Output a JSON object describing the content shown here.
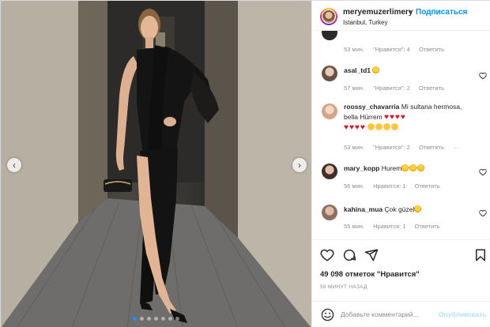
{
  "post": {
    "username": "meryemuzerlimery",
    "separator": "•",
    "follow_label": "Подписаться",
    "location": "Istanbul, Turkey",
    "likes": "49 098 отметок \"Нравится\"",
    "time_ago": "58 МИНУТ НАЗАД",
    "carousel_pages": 7,
    "carousel_active": 0
  },
  "comments": [
    {
      "username": "",
      "text": "",
      "time": "53 мин.",
      "likes": "\"Нравится\": 4",
      "reply": "Ответить",
      "avatar_color": "#2b2b2b"
    },
    {
      "username": "asal_td1",
      "text": "",
      "emojis": [
        "star"
      ],
      "time": "57 мин.",
      "likes": "\"Нравится\": 2",
      "reply": "Ответить",
      "avatar_color": "#9a8d86"
    },
    {
      "username": "roossy_chavarria",
      "text": "Mi sultana hermosa, bella Hürrem",
      "time": "53 мин.",
      "likes": "\"Нравится\": 2",
      "reply": "Ответить",
      "avatar_color": "#e7c3b0"
    },
    {
      "username": "mary_kopp",
      "text": "Hurem",
      "time": "56 мин.",
      "likes": "Нравится: 1",
      "reply": "Ответить",
      "avatar_color": "#5b4a45"
    },
    {
      "username": "kahina_mua",
      "text": "Çok güzel",
      "time": "55 мин.",
      "likes": "Нравится: 1",
      "reply": "Ответить",
      "avatar_color": "#b79a8e"
    }
  ],
  "comment_input": {
    "placeholder": "Добавьте комментарий...",
    "post_label": "Опубликовать"
  },
  "colors": {
    "accent": "#0095f6",
    "heart_red": "#d8172a",
    "muted": "#8e8e8e"
  }
}
